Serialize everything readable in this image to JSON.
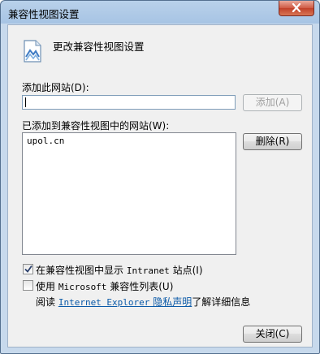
{
  "window": {
    "title": "兼容性视图设置"
  },
  "header": {
    "text": "更改兼容性视图设置"
  },
  "add_site": {
    "label": "添加此网站(D):",
    "value": "",
    "add_button": "添加(A)"
  },
  "site_list": {
    "label": "已添加到兼容性视图中的网站(W):",
    "items": [
      "upol.cn"
    ],
    "remove_button": "删除(R)"
  },
  "options": {
    "intranet": {
      "label_prefix": "在兼容性视图中显示 ",
      "label_mono": "Intranet",
      "label_suffix": " 站点(I)",
      "checked": true
    },
    "ms_list": {
      "label_prefix": "使用 ",
      "label_mono": "Microsoft",
      "label_suffix": " 兼容性列表(U)",
      "checked": false
    }
  },
  "privacy": {
    "prefix": "阅读 ",
    "link_mono": "Internet Explorer",
    "link_text": " 隐私声明",
    "suffix": "了解详细信息"
  },
  "footer": {
    "close_button": "关闭(C)"
  }
}
